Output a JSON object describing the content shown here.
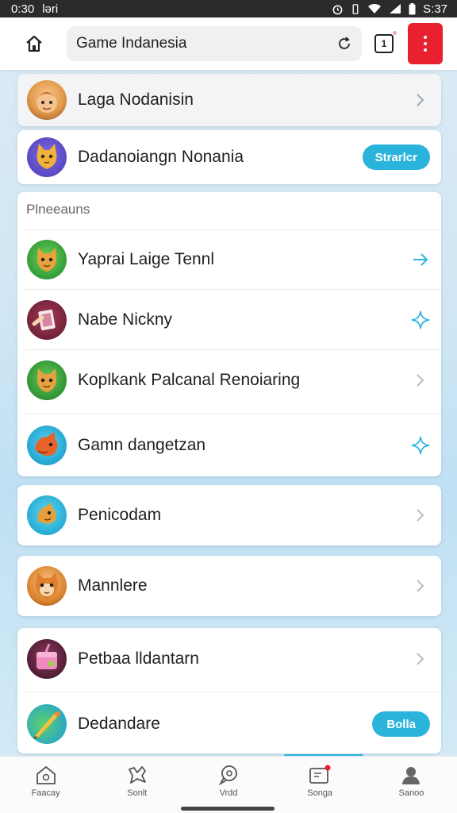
{
  "status": {
    "time": "0:30",
    "carrier": "ləri",
    "clock": "S:37"
  },
  "browser": {
    "url": "Game Indanesia",
    "tab_count": "1",
    "menu_icon": "more-vert-icon"
  },
  "top_items": [
    {
      "label": "Laga Nodanisin",
      "action": "chevron"
    },
    {
      "label": "Dadanoiangn Nonania",
      "action": "pill",
      "pill_label": "Strarlcr"
    }
  ],
  "section": {
    "title": "Plneeauns",
    "items": [
      {
        "label": "Yaprai Laige Tennl",
        "action": "arrow"
      },
      {
        "label": "Nabe Nickny",
        "action": "sparkle"
      },
      {
        "label": "Koplkank Palcanal Renoiaring",
        "action": "chevron"
      },
      {
        "label": "Gamn dangetzan",
        "action": "sparkle"
      }
    ]
  },
  "more_items": [
    {
      "label": "Penicodam",
      "action": "chevron"
    },
    {
      "label": "Mannlere",
      "action": "chevron"
    },
    {
      "label": "Petbaa lldantarn",
      "action": "chevron"
    },
    {
      "label": "Dedandare",
      "action": "pill",
      "pill_label": "Bolla"
    }
  ],
  "bottom_nav": [
    {
      "label": "Faacay",
      "icon": "home-icon"
    },
    {
      "label": "Sonlt",
      "icon": "puzzle-icon"
    },
    {
      "label": "Vrdd",
      "icon": "chat-icon"
    },
    {
      "label": "Songa",
      "icon": "inbox-icon"
    },
    {
      "label": "Sanoo",
      "icon": "profile-icon"
    }
  ],
  "colors": {
    "accent": "#2ab4dc",
    "menu_red": "#e8202f"
  }
}
